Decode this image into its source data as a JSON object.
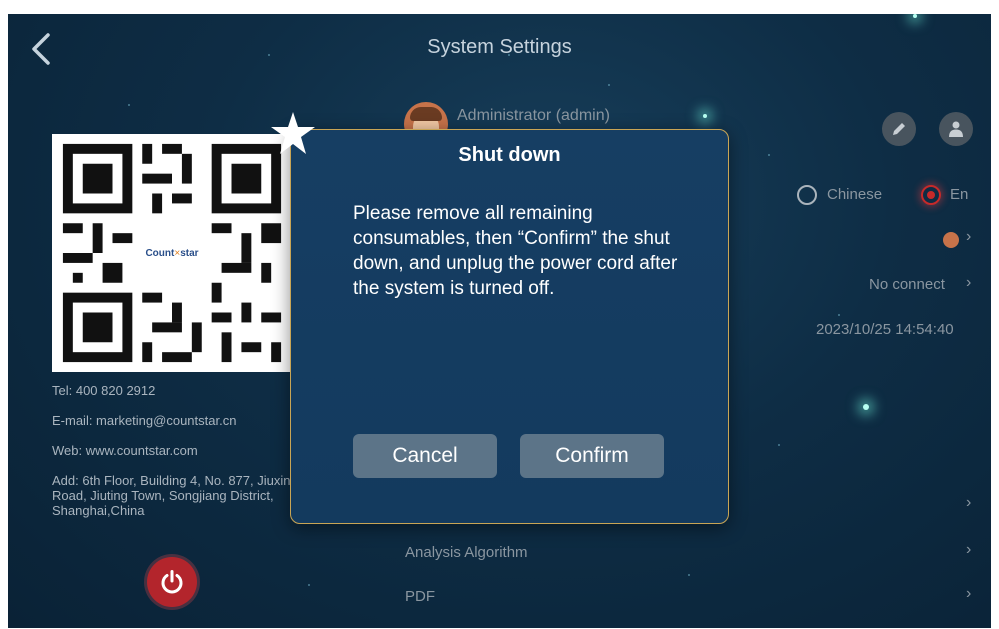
{
  "header": {
    "title": "System Settings"
  },
  "contact": {
    "qr_logo_brand": "Count",
    "qr_logo_star": "star",
    "tel": "Tel: 400 820 2912",
    "email": "E-mail: marketing@countstar.cn",
    "web": "Web: www.countstar.com",
    "address": "Add: 6th Floor, Building 4, No. 877, Jiuxin Road, Jiuting Town, Songjiang District, Shanghai,China"
  },
  "settings": {
    "admin_name": "Administrator (admin)",
    "language_chinese": "Chinese",
    "language_en": "En",
    "language_selected": "En",
    "connection_status": "No connect",
    "datetime": "2023/10/25 14:54:40",
    "analysis_algorithm": "Analysis Algorithm",
    "pdf": "PDF",
    "chevron": "›"
  },
  "dialog": {
    "title": "Shut down",
    "message": "Please remove all remaining consumables, then “Confirm” the shut down, and unplug the power cord after the system is turned off.",
    "cancel_label": "Cancel",
    "confirm_label": "Confirm"
  },
  "colors": {
    "background": "#0e2d45",
    "dialog_bg": "#163e63",
    "dialog_border": "#c9a555",
    "button_bg": "#5c7488",
    "power_red": "#b3252c",
    "radio_selected": "#c62a2a"
  },
  "icons": {
    "back": "chevron-left-icon",
    "edit": "edit-icon",
    "user": "user-icon",
    "power": "power-icon",
    "star": "star-icon"
  }
}
